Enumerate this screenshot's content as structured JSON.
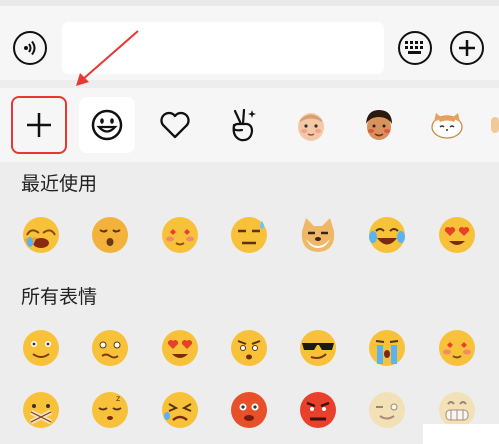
{
  "toolbar": {
    "input_value": "",
    "voice_icon": "voice-icon",
    "keyboard_icon": "keyboard-icon",
    "add_icon": "plus-icon"
  },
  "tabs": [
    {
      "name": "add-emoji",
      "icon": "plus-icon",
      "selected": false
    },
    {
      "name": "default-emoji",
      "icon": "smiley-icon",
      "selected": true
    },
    {
      "name": "favorites",
      "icon": "heart-icon",
      "selected": false
    },
    {
      "name": "gestures",
      "icon": "victory-hand-icon",
      "selected": false
    },
    {
      "name": "baby-sticker",
      "icon": "baby-face-icon",
      "selected": false
    },
    {
      "name": "boy-sticker",
      "icon": "boy-face-icon",
      "selected": false
    },
    {
      "name": "cat-sticker",
      "icon": "cat-face-icon",
      "selected": false
    }
  ],
  "recent": {
    "title": "最近使用",
    "emojis": [
      "face-covering-laugh",
      "kissing-face",
      "love-face",
      "sweat-face",
      "doge",
      "tears-of-joy",
      "heart-eyes"
    ]
  },
  "all": {
    "title": "所有表情",
    "row1": [
      "smile",
      "embarrassed",
      "heart-eyes",
      "angry-squint",
      "cool-sunglasses",
      "crying",
      "love-face"
    ],
    "row2": [
      "mute",
      "sleepy",
      "frustrated",
      "angry-red",
      "furious",
      "wink",
      "grin"
    ]
  },
  "colors": {
    "annotation": "#e53935"
  }
}
